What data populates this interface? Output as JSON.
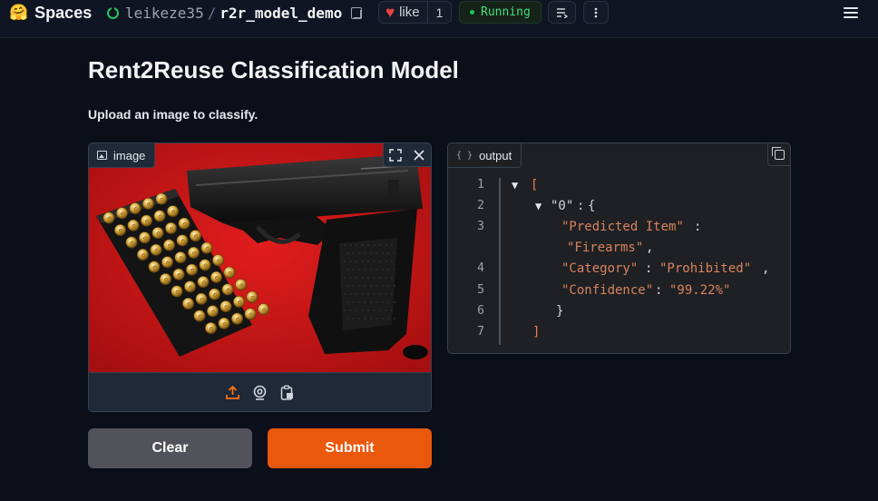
{
  "header": {
    "brand_label": "Spaces",
    "owner": "leikeze35",
    "separator": "/",
    "space_name": "r2r_model_demo",
    "like_label": "like",
    "like_count": "1",
    "status_label": "Running"
  },
  "page": {
    "title": "Rent2Reuse Classification Model",
    "description": "Upload an image to classify."
  },
  "input_panel": {
    "label": "image",
    "icons": [
      "fullscreen-icon",
      "close-icon",
      "upload-icon",
      "webcam-icon",
      "clipboard-icon"
    ],
    "image_subject": "black pistol beside a tray of brass cartridges on red background"
  },
  "output_panel": {
    "label": "output",
    "braces_icon": "{ }",
    "json_lines": {
      "l1": {
        "num": "1",
        "text": "["
      },
      "l2": {
        "num": "2",
        "key": "\"0\"",
        "after": ":",
        "open": "{"
      },
      "l3": {
        "num": "3",
        "key": "\"Predicted Item\"",
        "after": ":",
        "value": "\"Firearms\"",
        "trail": ","
      },
      "l4": {
        "num": "4",
        "key": "\"Category\"",
        "after": ": ",
        "value": "\"Prohibited\"",
        "trail": ","
      },
      "l5": {
        "num": "5",
        "key": "\"Confidence\"",
        "after": ": ",
        "value": "\"99.22%\""
      },
      "l6": {
        "num": "6",
        "text": "}"
      },
      "l7": {
        "num": "7",
        "text": "]"
      }
    }
  },
  "actions": {
    "clear_label": "Clear",
    "submit_label": "Submit"
  },
  "colors": {
    "background": "#0b0f19",
    "accent_submit": "#ea580c",
    "clear_button": "#52525b",
    "status_green": "#22c55e",
    "heart_red": "#ef4444"
  }
}
